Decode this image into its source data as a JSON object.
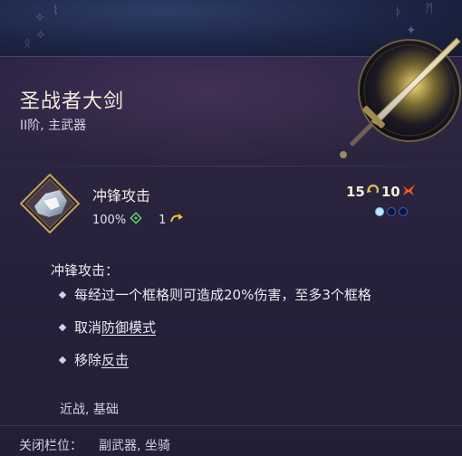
{
  "item": {
    "name": "圣战者大剑",
    "subtitle": "II阶, 主武器",
    "emblem_icon": "greatsword-icon"
  },
  "skill": {
    "name": "冲锋攻击",
    "icon": "charge-skill-icon",
    "accuracy": "100%",
    "range": "1",
    "cost_ap": "15",
    "cost_rage": "10",
    "slots": {
      "filled": 1,
      "total": 3
    }
  },
  "description": {
    "heading": "冲锋攻击：",
    "item1": "每经过一个框格则可造成20%伤害，至多3个框格",
    "item2_prefix": "取消",
    "item2_keyword": "防御模式",
    "item3_prefix": "移除",
    "item3_keyword": "反击",
    "tags": "近战, 基础"
  },
  "footer": {
    "label": "关闭栏位：",
    "value": "副武器, 坐骑"
  },
  "colors": {
    "title": "#f2ecdc",
    "slot_filled": "#bfe4ff",
    "slot_empty": "#0e1638",
    "rage": "#ff5a2a",
    "accuracy": "#5fd06a",
    "range_arrow": "#f0c030"
  }
}
